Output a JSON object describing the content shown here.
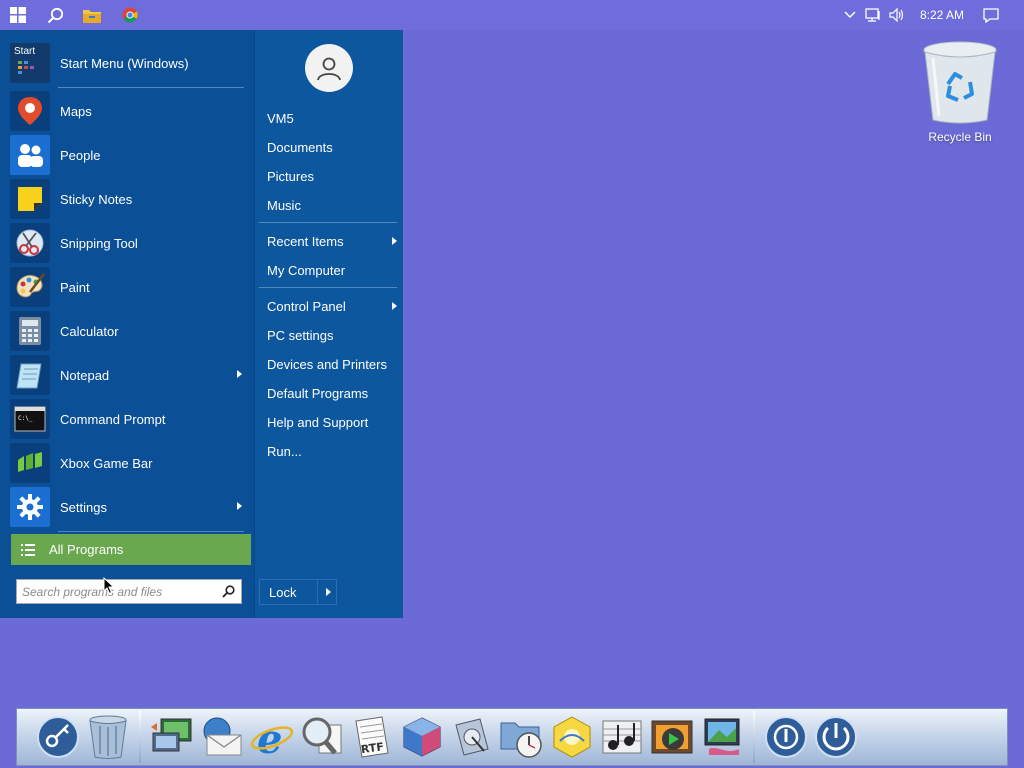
{
  "taskbar": {
    "clock": "8:22 AM",
    "icons": [
      "windows-start-icon",
      "search-icon",
      "file-explorer-icon",
      "chrome-icon"
    ],
    "tray_icons": [
      "chevron-up-icon",
      "network-icon",
      "volume-icon",
      "notification-icon"
    ]
  },
  "desktop": {
    "icons": [
      {
        "label": "Recycle Bin",
        "icon": "recycle-bin-icon"
      }
    ]
  },
  "start_menu": {
    "header": {
      "label": "Start Menu (Windows)",
      "icon_text": "Start"
    },
    "programs": [
      {
        "label": "Maps",
        "icon": "maps-icon",
        "submenu": false
      },
      {
        "label": "People",
        "icon": "people-icon",
        "submenu": false
      },
      {
        "label": "Sticky Notes",
        "icon": "sticky-notes-icon",
        "submenu": false
      },
      {
        "label": "Snipping Tool",
        "icon": "snipping-tool-icon",
        "submenu": false
      },
      {
        "label": "Paint",
        "icon": "paint-icon",
        "submenu": false
      },
      {
        "label": "Calculator",
        "icon": "calculator-icon",
        "submenu": false
      },
      {
        "label": "Notepad",
        "icon": "notepad-icon",
        "submenu": true
      },
      {
        "label": "Command Prompt",
        "icon": "command-prompt-icon",
        "submenu": false
      },
      {
        "label": "Xbox Game Bar",
        "icon": "xbox-game-bar-icon",
        "submenu": false
      },
      {
        "label": "Settings",
        "icon": "settings-gear-icon",
        "submenu": true
      }
    ],
    "all_programs": "All Programs",
    "search": {
      "placeholder": "Search programs and files",
      "value": ""
    },
    "right": {
      "user": "VM5",
      "items_a": [
        "Documents",
        "Pictures",
        "Music"
      ],
      "recent": "Recent Items",
      "my_computer": "My Computer",
      "control_panel": "Control Panel",
      "items_b": [
        "PC settings",
        "Devices and Printers",
        "Default Programs",
        "Help and Support",
        "Run..."
      ],
      "lock": "Lock"
    }
  },
  "dock": {
    "icons": [
      "keychain-icon",
      "trash-icon",
      "network-transfer-icon",
      "mail-icon",
      "internet-explorer-icon",
      "magnifier-icon",
      "rtf-document-icon",
      "cube-app-icon",
      "disk-utility-icon",
      "folder-clock-icon",
      "sun-hexagon-icon",
      "music-notes-icon",
      "media-player-icon",
      "paint-display-icon",
      "power-icon",
      "shutdown-icon"
    ]
  },
  "colors": {
    "desktop": "#6b6ad6",
    "start_menu": "#0b4f97",
    "all_programs": "#6aa84f"
  }
}
